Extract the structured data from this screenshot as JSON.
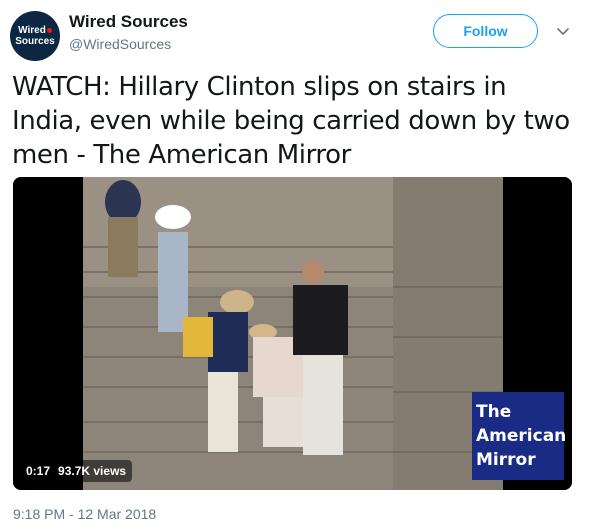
{
  "account": {
    "avatar_line1": "Wired",
    "avatar_line2": "Sources",
    "name": "Wired Sources",
    "handle": "@WiredSources"
  },
  "actions": {
    "follow_label": "Follow",
    "more_icon": "chevron-down-icon"
  },
  "tweet": {
    "text": "WATCH: Hillary Clinton slips on stairs in India, even while being carried down by two men - The American Mirror",
    "timestamp": "9:18 PM - 12 Mar 2018"
  },
  "video": {
    "duration": "0:17",
    "views": "93.7K views",
    "watermark_line1": "The",
    "watermark_line2": "American",
    "watermark_line3": "Mirror"
  },
  "colors": {
    "accent": "#1da1f2",
    "text": "#14171a",
    "secondary": "#657786",
    "watermark_bg": "#1a2b86"
  }
}
